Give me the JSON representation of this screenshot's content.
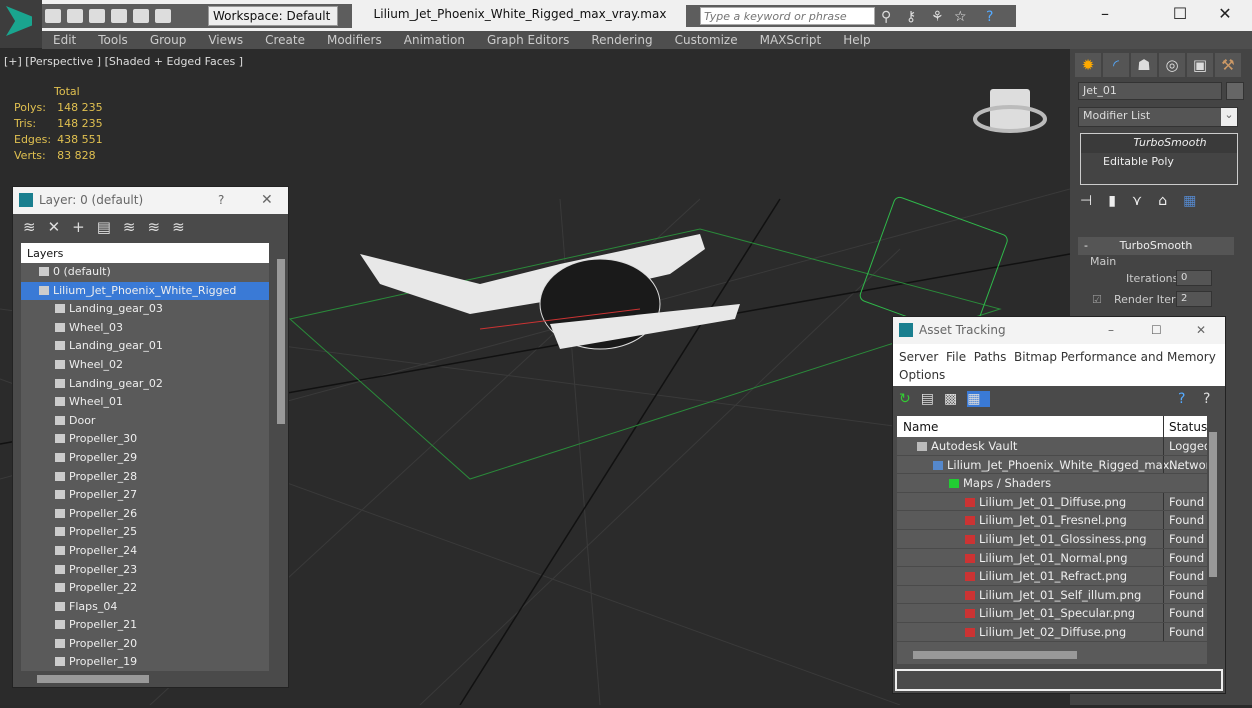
{
  "app": {
    "title": "Lilium_Jet_Phoenix_White_Rigged_max_vray.max",
    "workspace": "Workspace: Default",
    "search_placeholder": "Type a keyword or phrase"
  },
  "menu": [
    "Edit",
    "Tools",
    "Group",
    "Views",
    "Create",
    "Modifiers",
    "Animation",
    "Graph Editors",
    "Rendering",
    "Customize",
    "MAXScript",
    "Help"
  ],
  "viewport": {
    "label": "[+] [Perspective ] [Shaded + Edged Faces ]",
    "stats": {
      "header": "Total",
      "rows": [
        [
          "Polys:",
          "148 235"
        ],
        [
          "Tris:",
          "148 235"
        ],
        [
          "Edges:",
          "438 551"
        ],
        [
          "Verts:",
          "83 828"
        ]
      ]
    }
  },
  "command_panel": {
    "object_name": "Jet_01",
    "modifier_list": "Modifier List",
    "stack": [
      "TurboSmooth",
      "Editable Poly"
    ],
    "rollout": {
      "title": "TurboSmooth",
      "group": "Main",
      "iterations_label": "Iterations:",
      "iterations": "0",
      "render_iters_label": "Render Iters:",
      "render_iters": "2",
      "render_iters_checked": true
    }
  },
  "layer_dialog": {
    "title": "Layer: 0 (default)",
    "help": "?",
    "header": "Layers",
    "layers": [
      "0 (default)",
      "Lilium_Jet_Phoenix_White_Rigged"
    ],
    "objects": [
      "Landing_gear_03",
      "Wheel_03",
      "Landing_gear_01",
      "Wheel_02",
      "Landing_gear_02",
      "Wheel_01",
      "Door",
      "Propeller_30",
      "Propeller_29",
      "Propeller_28",
      "Propeller_27",
      "Propeller_26",
      "Propeller_25",
      "Propeller_24",
      "Propeller_23",
      "Propeller_22",
      "Flaps_04",
      "Propeller_21",
      "Propeller_20",
      "Propeller_19"
    ]
  },
  "asset_tracking": {
    "title": "Asset Tracking",
    "menu": [
      "Server",
      "File",
      "Paths",
      "Bitmap Performance and Memory",
      "Options"
    ],
    "columns": [
      "Name",
      "Status"
    ],
    "rows": [
      {
        "name": "Autodesk Vault",
        "status": "Logged",
        "level": 1
      },
      {
        "name": "Lilium_Jet_Phoenix_White_Rigged_max...",
        "status": "Networ",
        "level": 2
      },
      {
        "name": "Maps / Shaders",
        "status": "",
        "level": 3
      },
      {
        "name": "Lilium_Jet_01_Diffuse.png",
        "status": "Found",
        "level": 4
      },
      {
        "name": "Lilium_Jet_01_Fresnel.png",
        "status": "Found",
        "level": 4
      },
      {
        "name": "Lilium_Jet_01_Glossiness.png",
        "status": "Found",
        "level": 4
      },
      {
        "name": "Lilium_Jet_01_Normal.png",
        "status": "Found",
        "level": 4
      },
      {
        "name": "Lilium_Jet_01_Refract.png",
        "status": "Found",
        "level": 4
      },
      {
        "name": "Lilium_Jet_01_Self_illum.png",
        "status": "Found",
        "level": 4
      },
      {
        "name": "Lilium_Jet_01_Specular.png",
        "status": "Found",
        "level": 4
      },
      {
        "name": "Lilium_Jet_02_Diffuse.png",
        "status": "Found",
        "level": 4
      }
    ]
  },
  "colors": {
    "accent": "#3a7ad6",
    "stats": "#e0c050",
    "helper": "#2fb84a"
  }
}
